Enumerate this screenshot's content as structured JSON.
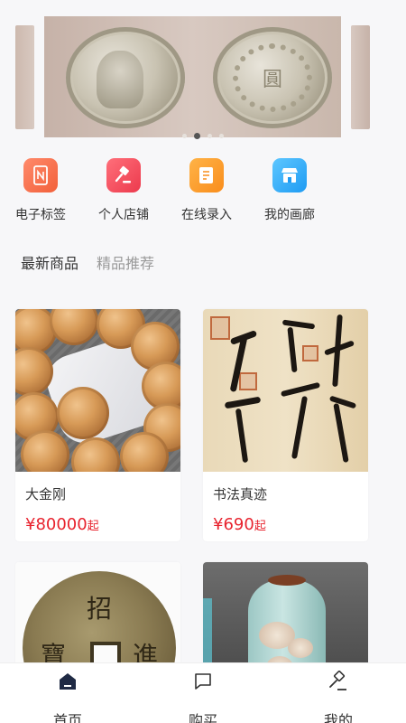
{
  "banner": {
    "dots": 4,
    "active_dot": 1,
    "coin_back_char": "圓"
  },
  "functions": [
    {
      "label": "电子标签",
      "icon": "nfc-tag-icon",
      "color": "#f2603a"
    },
    {
      "label": "个人店铺",
      "icon": "auction-hammer-icon",
      "color": "#ec3a4d"
    },
    {
      "label": "在线录入",
      "icon": "edit-form-icon",
      "color": "#f98d1c"
    },
    {
      "label": "我的画廊",
      "icon": "storefront-icon",
      "color": "#1e9bf3"
    }
  ],
  "tabs": [
    {
      "label": "最新商品",
      "active": true
    },
    {
      "label": "精品推荐",
      "active": false
    }
  ],
  "goods": [
    {
      "name": "大金刚",
      "currency": "¥",
      "price": "80000",
      "suffix": "起"
    },
    {
      "name": "书法真迹",
      "currency": "¥",
      "price": "690",
      "suffix": "起"
    },
    {
      "image_text": [
        "招",
        "進",
        "寶"
      ]
    },
    {}
  ],
  "tabbar": [
    {
      "label": "首页",
      "icon": "home-icon",
      "active": true
    },
    {
      "label": "购买",
      "icon": "chat-bubble-icon",
      "active": false
    },
    {
      "label": "我的",
      "icon": "hammer-icon",
      "active": false
    }
  ],
  "colors": {
    "price": "#e8232e",
    "active_nav": "#1f2a44",
    "background": "#f7f7f9"
  }
}
